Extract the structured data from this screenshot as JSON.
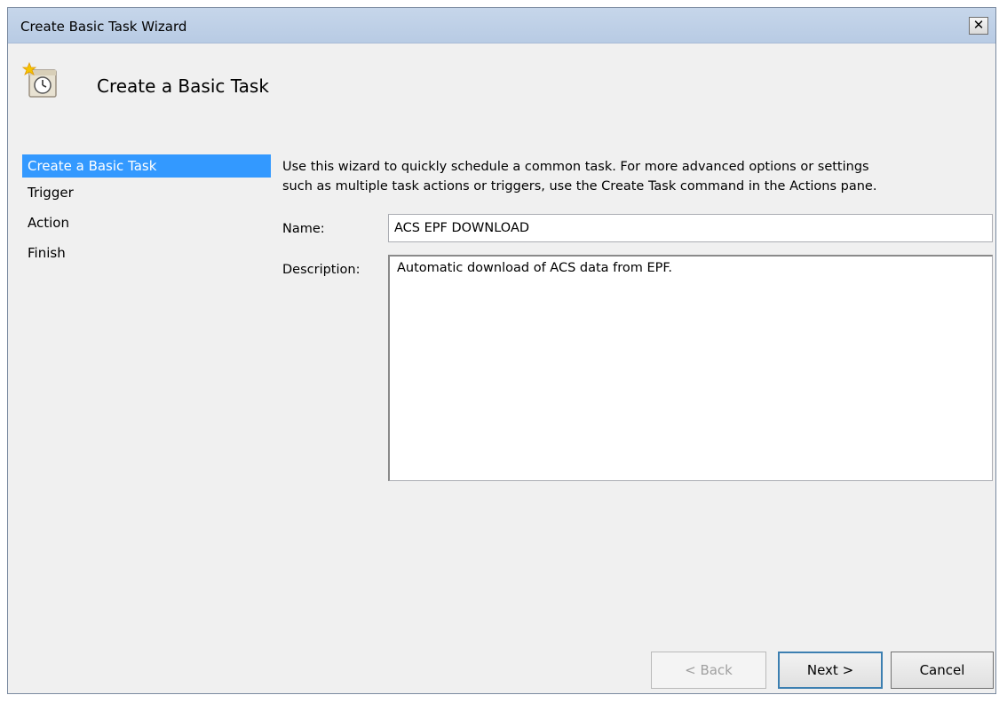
{
  "window": {
    "title": "Create Basic Task Wizard",
    "close_glyph": "✕"
  },
  "header": {
    "title": "Create a Basic Task",
    "icon": "scheduled-task-clock-icon"
  },
  "steps": [
    {
      "label": "Create a Basic Task",
      "active": true
    },
    {
      "label": "Trigger",
      "active": false
    },
    {
      "label": "Action",
      "active": false
    },
    {
      "label": "Finish",
      "active": false
    }
  ],
  "content": {
    "intro_line1": "Use this wizard to quickly schedule a common task.  For more advanced options or settings",
    "intro_line2": "such as multiple task actions or triggers, use the Create Task command in the Actions pane.",
    "name_label": "Name:",
    "name_value": "ACS EPF DOWNLOAD",
    "description_label": "Description:",
    "description_value": "Automatic download of ACS data from EPF."
  },
  "buttons": {
    "back": "< Back",
    "next": "Next >",
    "cancel": "Cancel"
  },
  "colors": {
    "selection": "#3399ff",
    "titlebar": "#c6d6ea",
    "window_bg": "#f0f0f0"
  }
}
